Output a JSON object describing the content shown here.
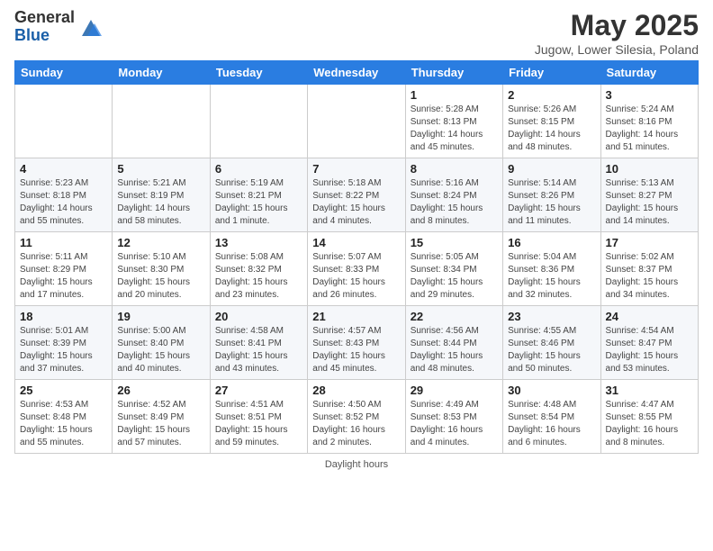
{
  "header": {
    "logo_general": "General",
    "logo_blue": "Blue",
    "month_title": "May 2025",
    "subtitle": "Jugow, Lower Silesia, Poland"
  },
  "days_of_week": [
    "Sunday",
    "Monday",
    "Tuesday",
    "Wednesday",
    "Thursday",
    "Friday",
    "Saturday"
  ],
  "weeks": [
    [
      {
        "day": "",
        "info": ""
      },
      {
        "day": "",
        "info": ""
      },
      {
        "day": "",
        "info": ""
      },
      {
        "day": "",
        "info": ""
      },
      {
        "day": "1",
        "info": "Sunrise: 5:28 AM\nSunset: 8:13 PM\nDaylight: 14 hours\nand 45 minutes."
      },
      {
        "day": "2",
        "info": "Sunrise: 5:26 AM\nSunset: 8:15 PM\nDaylight: 14 hours\nand 48 minutes."
      },
      {
        "day": "3",
        "info": "Sunrise: 5:24 AM\nSunset: 8:16 PM\nDaylight: 14 hours\nand 51 minutes."
      }
    ],
    [
      {
        "day": "4",
        "info": "Sunrise: 5:23 AM\nSunset: 8:18 PM\nDaylight: 14 hours\nand 55 minutes."
      },
      {
        "day": "5",
        "info": "Sunrise: 5:21 AM\nSunset: 8:19 PM\nDaylight: 14 hours\nand 58 minutes."
      },
      {
        "day": "6",
        "info": "Sunrise: 5:19 AM\nSunset: 8:21 PM\nDaylight: 15 hours\nand 1 minute."
      },
      {
        "day": "7",
        "info": "Sunrise: 5:18 AM\nSunset: 8:22 PM\nDaylight: 15 hours\nand 4 minutes."
      },
      {
        "day": "8",
        "info": "Sunrise: 5:16 AM\nSunset: 8:24 PM\nDaylight: 15 hours\nand 8 minutes."
      },
      {
        "day": "9",
        "info": "Sunrise: 5:14 AM\nSunset: 8:26 PM\nDaylight: 15 hours\nand 11 minutes."
      },
      {
        "day": "10",
        "info": "Sunrise: 5:13 AM\nSunset: 8:27 PM\nDaylight: 15 hours\nand 14 minutes."
      }
    ],
    [
      {
        "day": "11",
        "info": "Sunrise: 5:11 AM\nSunset: 8:29 PM\nDaylight: 15 hours\nand 17 minutes."
      },
      {
        "day": "12",
        "info": "Sunrise: 5:10 AM\nSunset: 8:30 PM\nDaylight: 15 hours\nand 20 minutes."
      },
      {
        "day": "13",
        "info": "Sunrise: 5:08 AM\nSunset: 8:32 PM\nDaylight: 15 hours\nand 23 minutes."
      },
      {
        "day": "14",
        "info": "Sunrise: 5:07 AM\nSunset: 8:33 PM\nDaylight: 15 hours\nand 26 minutes."
      },
      {
        "day": "15",
        "info": "Sunrise: 5:05 AM\nSunset: 8:34 PM\nDaylight: 15 hours\nand 29 minutes."
      },
      {
        "day": "16",
        "info": "Sunrise: 5:04 AM\nSunset: 8:36 PM\nDaylight: 15 hours\nand 32 minutes."
      },
      {
        "day": "17",
        "info": "Sunrise: 5:02 AM\nSunset: 8:37 PM\nDaylight: 15 hours\nand 34 minutes."
      }
    ],
    [
      {
        "day": "18",
        "info": "Sunrise: 5:01 AM\nSunset: 8:39 PM\nDaylight: 15 hours\nand 37 minutes."
      },
      {
        "day": "19",
        "info": "Sunrise: 5:00 AM\nSunset: 8:40 PM\nDaylight: 15 hours\nand 40 minutes."
      },
      {
        "day": "20",
        "info": "Sunrise: 4:58 AM\nSunset: 8:41 PM\nDaylight: 15 hours\nand 43 minutes."
      },
      {
        "day": "21",
        "info": "Sunrise: 4:57 AM\nSunset: 8:43 PM\nDaylight: 15 hours\nand 45 minutes."
      },
      {
        "day": "22",
        "info": "Sunrise: 4:56 AM\nSunset: 8:44 PM\nDaylight: 15 hours\nand 48 minutes."
      },
      {
        "day": "23",
        "info": "Sunrise: 4:55 AM\nSunset: 8:46 PM\nDaylight: 15 hours\nand 50 minutes."
      },
      {
        "day": "24",
        "info": "Sunrise: 4:54 AM\nSunset: 8:47 PM\nDaylight: 15 hours\nand 53 minutes."
      }
    ],
    [
      {
        "day": "25",
        "info": "Sunrise: 4:53 AM\nSunset: 8:48 PM\nDaylight: 15 hours\nand 55 minutes."
      },
      {
        "day": "26",
        "info": "Sunrise: 4:52 AM\nSunset: 8:49 PM\nDaylight: 15 hours\nand 57 minutes."
      },
      {
        "day": "27",
        "info": "Sunrise: 4:51 AM\nSunset: 8:51 PM\nDaylight: 15 hours\nand 59 minutes."
      },
      {
        "day": "28",
        "info": "Sunrise: 4:50 AM\nSunset: 8:52 PM\nDaylight: 16 hours\nand 2 minutes."
      },
      {
        "day": "29",
        "info": "Sunrise: 4:49 AM\nSunset: 8:53 PM\nDaylight: 16 hours\nand 4 minutes."
      },
      {
        "day": "30",
        "info": "Sunrise: 4:48 AM\nSunset: 8:54 PM\nDaylight: 16 hours\nand 6 minutes."
      },
      {
        "day": "31",
        "info": "Sunrise: 4:47 AM\nSunset: 8:55 PM\nDaylight: 16 hours\nand 8 minutes."
      }
    ]
  ],
  "footer": {
    "note": "Daylight hours"
  }
}
